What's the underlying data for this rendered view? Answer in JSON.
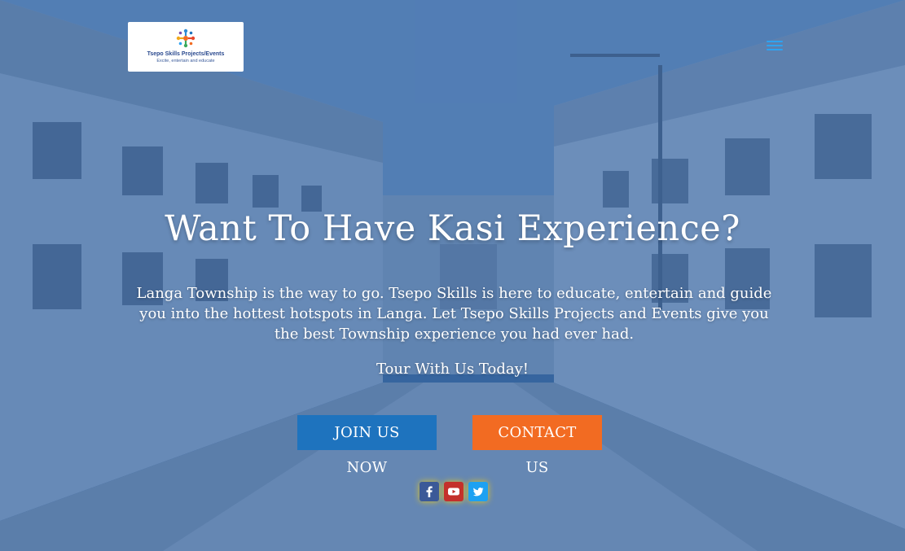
{
  "header": {
    "logo_title": "Tsepo Skills Projects/Events",
    "logo_tagline": "Excite, entertain and educate",
    "menu_icon": "hamburger-icon"
  },
  "hero": {
    "headline": "Want To Have Kasi Experience?",
    "intro": "Langa Township is the way to go. Tsepo Skills is here to educate, entertain and guide you into the hottest hotspots in Langa. Let Tsepo Skills Projects and Events give you the best Township experience you had ever had.",
    "cta_line": "Tour With Us Today!",
    "join_label": "JOIN US NOW",
    "contact_label": "CONTACT US"
  },
  "social": [
    {
      "icon": "facebook-icon",
      "color": "#3b5998"
    },
    {
      "icon": "youtube-icon",
      "color": "#c4302b"
    },
    {
      "icon": "twitter-icon",
      "color": "#1da1f2"
    }
  ],
  "colors": {
    "overlay": "#245ca8",
    "join_button": "#1e73be",
    "contact_button": "#f26b22",
    "menu_icon": "#2ea3f2"
  }
}
